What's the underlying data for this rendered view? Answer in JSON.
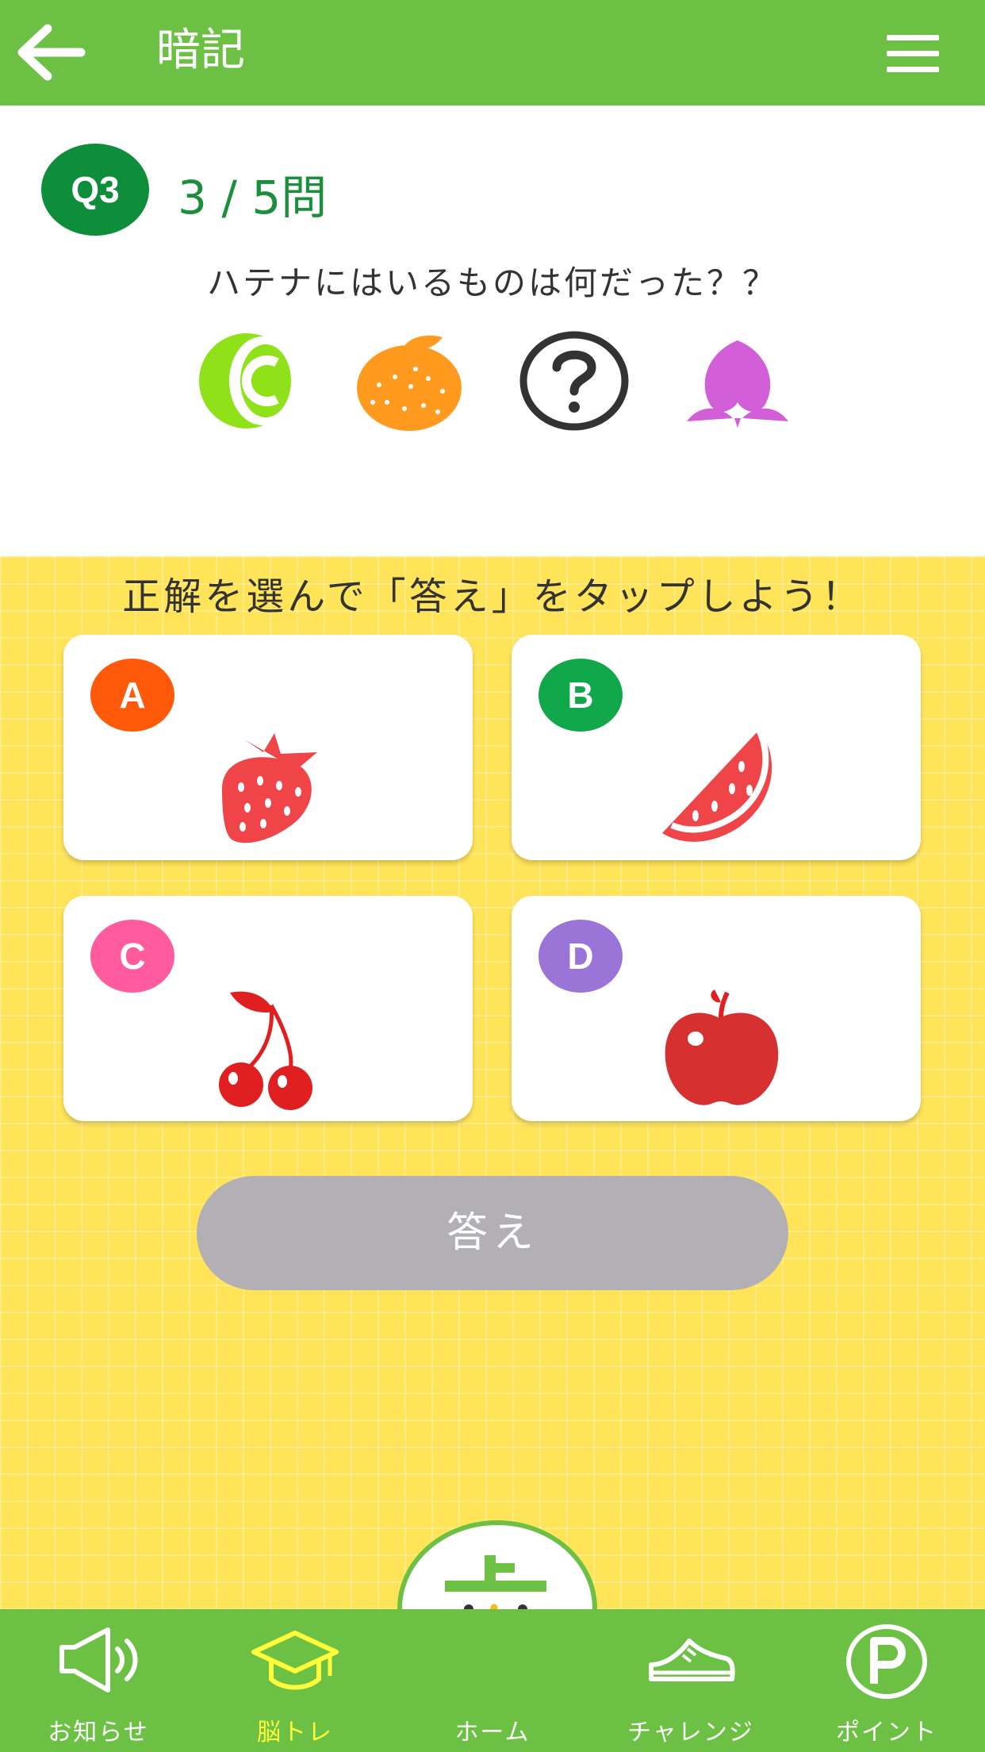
{
  "header": {
    "title": "暗記",
    "back_icon": "arrow-left-icon",
    "menu_icon": "hamburger-menu-icon"
  },
  "question": {
    "badge": "Q3",
    "progress": "3 / 5問",
    "text": "ハテナにはいるものは何だった？？",
    "sequence": [
      "lime-icon",
      "orange-icon",
      "question-mark-icon",
      "peach-icon"
    ]
  },
  "instruction": "正解を選んで「答え」をタップしよう！",
  "choices": [
    {
      "label": "A",
      "icon": "strawberry-icon",
      "color": "#ff5a0a"
    },
    {
      "label": "B",
      "icon": "watermelon-icon",
      "color": "#10a84a"
    },
    {
      "label": "C",
      "icon": "cherry-icon",
      "color": "#ff5b9e"
    },
    {
      "label": "D",
      "icon": "apple-icon",
      "color": "#9b74d8"
    }
  ],
  "answer_button": "答え",
  "bottom_nav": {
    "items": [
      {
        "label": "お知らせ",
        "icon": "megaphone-icon"
      },
      {
        "label": "脳トレ",
        "icon": "graduation-cap-icon",
        "active": true
      },
      {
        "label": "ホーム",
        "icon": "home-mascot-icon"
      },
      {
        "label": "チャレンジ",
        "icon": "sneaker-icon"
      },
      {
        "label": "ポイント",
        "icon": "point-p-icon"
      }
    ]
  },
  "colors": {
    "header_green": "#6cc144",
    "progress_green": "#1b8f3b",
    "background_yellow": "#ffe45a",
    "button_gray": "#b2b0b4",
    "active_nav": "#ffff3a"
  }
}
